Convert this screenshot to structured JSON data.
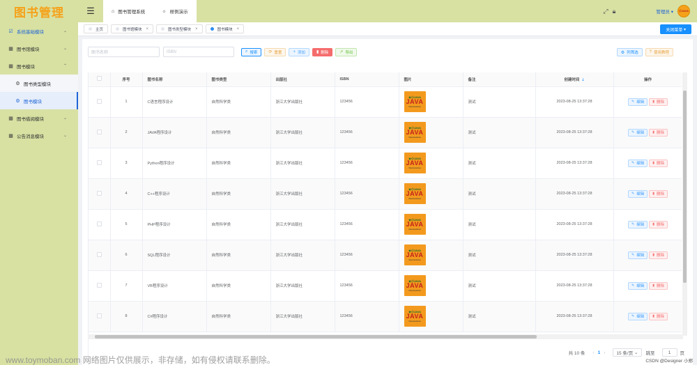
{
  "app": {
    "logo": "图书管理",
    "top_tabs": [
      {
        "label": "图书管理系统",
        "icon": "home-icon"
      },
      {
        "label": "样例演示",
        "icon": "sun-icon"
      }
    ],
    "user": "管理员",
    "avatar_text": "小JAVA"
  },
  "sidebar": {
    "items": [
      {
        "label": "系统基础模块",
        "icon": "checkbox-icon",
        "chev": "⌄"
      },
      {
        "label": "图书馆模块",
        "icon": "grid-icon",
        "chev": "⌄"
      },
      {
        "label": "图书模块",
        "icon": "grid-icon",
        "chev": "⌃"
      },
      {
        "label": "图书类型模块",
        "icon": "gear-icon"
      },
      {
        "label": "图书模块",
        "icon": "gear-icon"
      },
      {
        "label": "图书借阅模块",
        "icon": "grid-icon",
        "chev": "⌄"
      },
      {
        "label": "公告消息模块",
        "icon": "grid-icon",
        "chev": "⌄"
      }
    ]
  },
  "tags": [
    {
      "label": "主页",
      "closable": false
    },
    {
      "label": "图书馆模块",
      "closable": true
    },
    {
      "label": "图书类型模块",
      "closable": true
    },
    {
      "label": "图书模块",
      "closable": true,
      "active": true
    }
  ],
  "close_menu_label": "关闭菜单",
  "search": {
    "name_placeholder": "图书名称",
    "isbn_placeholder": "ISBN",
    "search_label": "搜索",
    "reset_label": "重置",
    "add_label": "添加",
    "delete_label": "删除",
    "export_label": "导出",
    "filter_label": "列筛选",
    "tutorial_label": "使用教程"
  },
  "table": {
    "headers": [
      "序号",
      "图书名称",
      "图书类型",
      "出版社",
      "ISBN",
      "图片",
      "备注",
      "创建时间",
      "操作"
    ],
    "image_text": {
      "top": "★小JAVA",
      "main": "JAVA",
      "bottom": "XiaoJavaJava"
    },
    "edit_label": "编辑",
    "delete_label": "删除",
    "rows": [
      {
        "no": "1",
        "name": "C语言程序设计",
        "type": "自然科学类",
        "publisher": "浙江大学出版社",
        "isbn": "123456",
        "remark": "测试",
        "created": "2023-08-25 13:37:28"
      },
      {
        "no": "2",
        "name": "JAVA程序设计",
        "type": "自然科学类",
        "publisher": "浙江大学出版社",
        "isbn": "123456",
        "remark": "测试",
        "created": "2023-08-25 13:37:28"
      },
      {
        "no": "3",
        "name": "Python程序设计",
        "type": "自然科学类",
        "publisher": "浙江大学出版社",
        "isbn": "123456",
        "remark": "测试",
        "created": "2023-08-25 13:37:28"
      },
      {
        "no": "4",
        "name": "C++程序设计",
        "type": "自然科学类",
        "publisher": "浙江大学出版社",
        "isbn": "123456",
        "remark": "测试",
        "created": "2023-08-25 13:37:28"
      },
      {
        "no": "5",
        "name": "PHP程序设计",
        "type": "自然科学类",
        "publisher": "浙江大学出版社",
        "isbn": "123456",
        "remark": "测试",
        "created": "2023-08-25 13:37:28"
      },
      {
        "no": "6",
        "name": "SQL程序设计",
        "type": "自然科学类",
        "publisher": "浙江大学出版社",
        "isbn": "123456",
        "remark": "测试",
        "created": "2023-08-25 13:37:28"
      },
      {
        "no": "7",
        "name": "VB程序设计",
        "type": "自然科学类",
        "publisher": "浙江大学出版社",
        "isbn": "123456",
        "remark": "测试",
        "created": "2023-08-25 13:37:28"
      },
      {
        "no": "8",
        "name": "C#程序设计",
        "type": "自然科学类",
        "publisher": "浙江大学出版社",
        "isbn": "123456",
        "remark": "测试",
        "created": "2023-08-25 13:37:28"
      }
    ]
  },
  "pagination": {
    "total": "共 10 条",
    "current_page": "1",
    "page_size": "15 条/页",
    "goto_label": "跳至",
    "goto_value": "1",
    "page_unit": "页"
  },
  "watermark": "www.toymoban.com 网络图片仅供展示，非存储，如有侵权请联系删除。",
  "credit": "CSDN @Designer 小郑"
}
